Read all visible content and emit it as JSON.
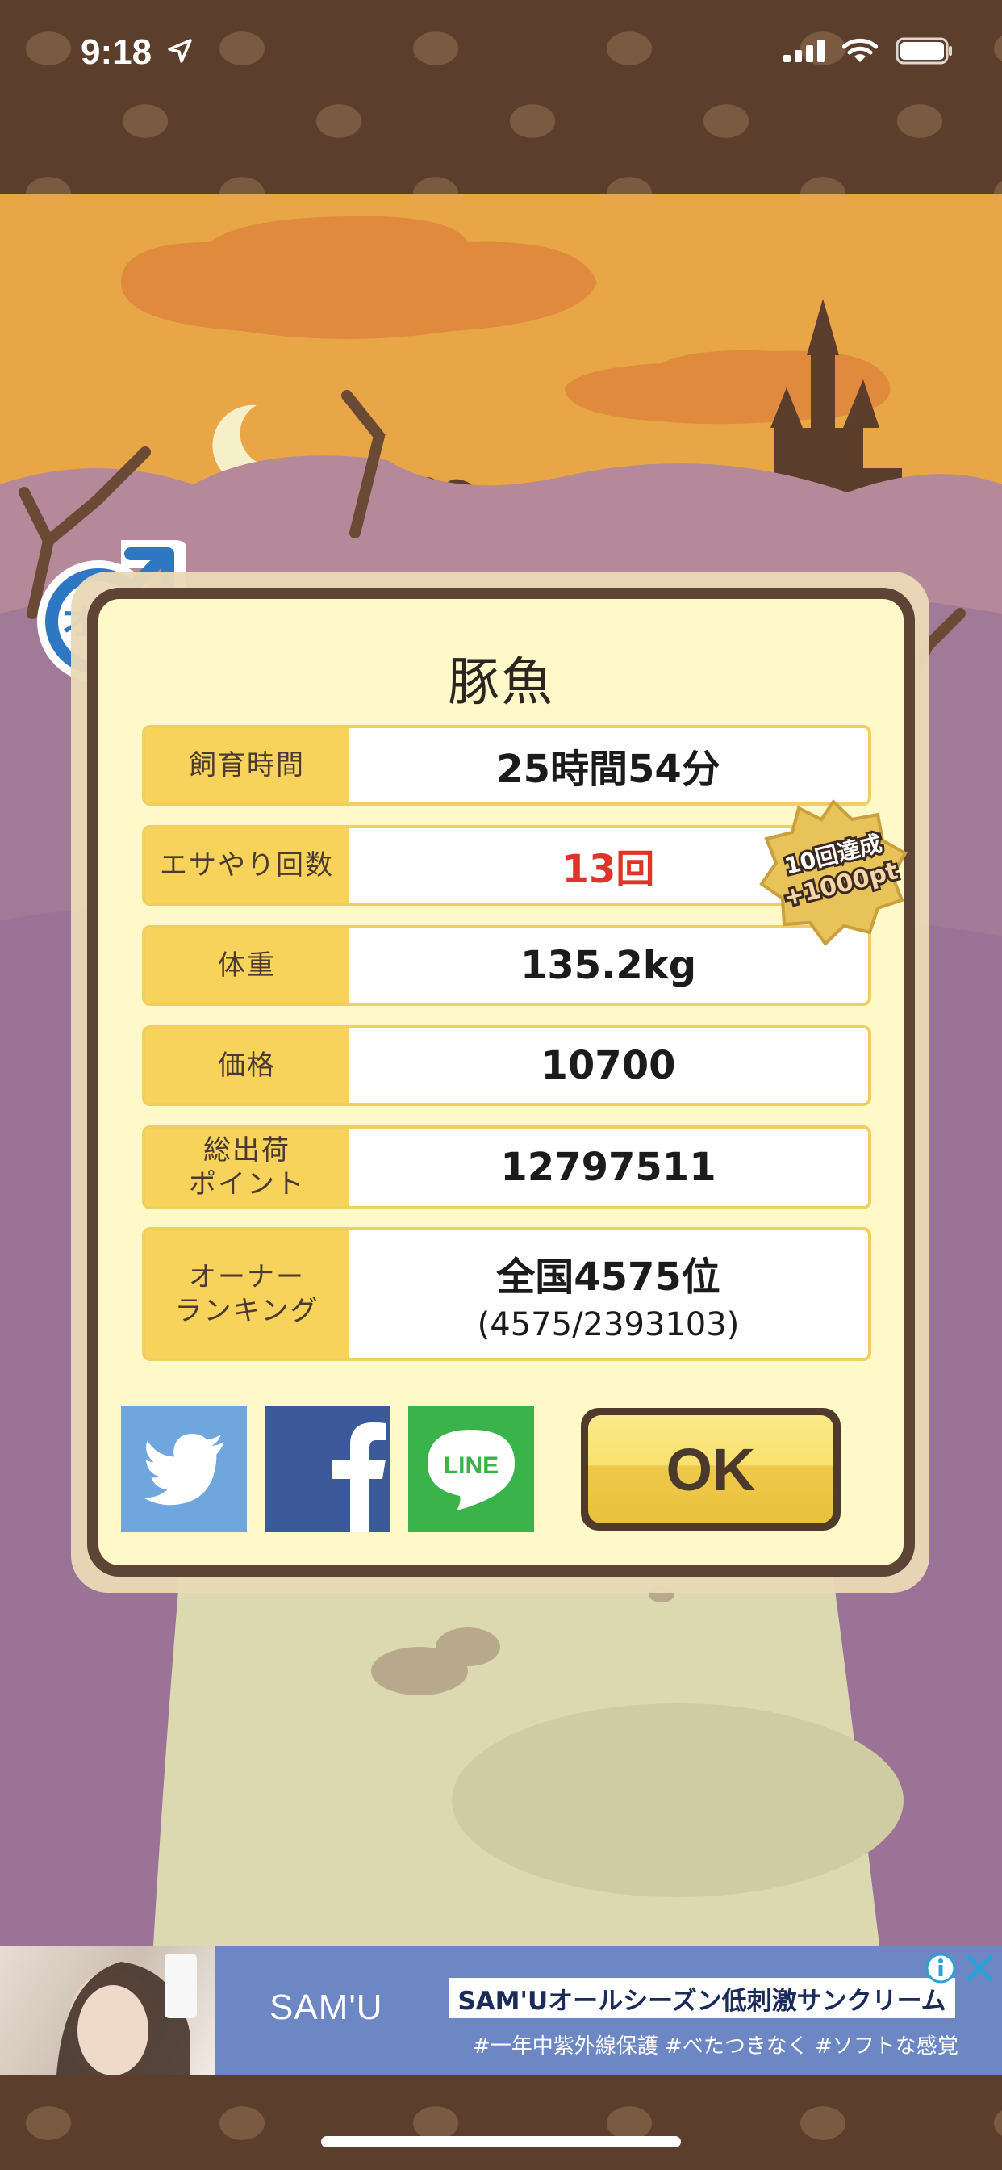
{
  "status_bar": {
    "time": "9:18"
  },
  "dialog": {
    "title": "豚魚",
    "rows": [
      {
        "label": "飼育時間",
        "value": "25時間54分"
      },
      {
        "label": "エサやり回数",
        "value": "13回"
      },
      {
        "label": "体重",
        "value": "135.2kg"
      },
      {
        "label": "価格",
        "value": "10700"
      },
      {
        "label": "総出荷\nポイント",
        "value": "12797511"
      },
      {
        "label": "オーナー\nランキング",
        "value": "全国4575位",
        "sub": "(4575/2393103)"
      }
    ],
    "badge": {
      "line1": "10回達成",
      "line2": "+1000pt"
    },
    "gender_label": "オス",
    "ok_label": "OK",
    "share": {
      "line_label": "LINE"
    }
  },
  "ad": {
    "brand": "SAM'U",
    "headline": "SAM'Uオールシーズン低刺激サンクリーム",
    "subtext": "#一年中紫外線保護 #べたつきなく #ソフトな感覚"
  },
  "colors": {
    "accent_yellow": "#f7d35c",
    "frame_brown": "#5e4434",
    "highlight_red": "#e03429",
    "twitter_blue": "#6ea6dd",
    "facebook_blue": "#3c5a99",
    "line_green": "#3ab44a"
  },
  "icons": [
    "location-arrow-icon",
    "signal-icon",
    "wifi-icon",
    "battery-icon",
    "male-symbol-icon",
    "twitter-icon",
    "facebook-icon",
    "line-icon",
    "ad-info-icon",
    "ad-close-icon"
  ]
}
